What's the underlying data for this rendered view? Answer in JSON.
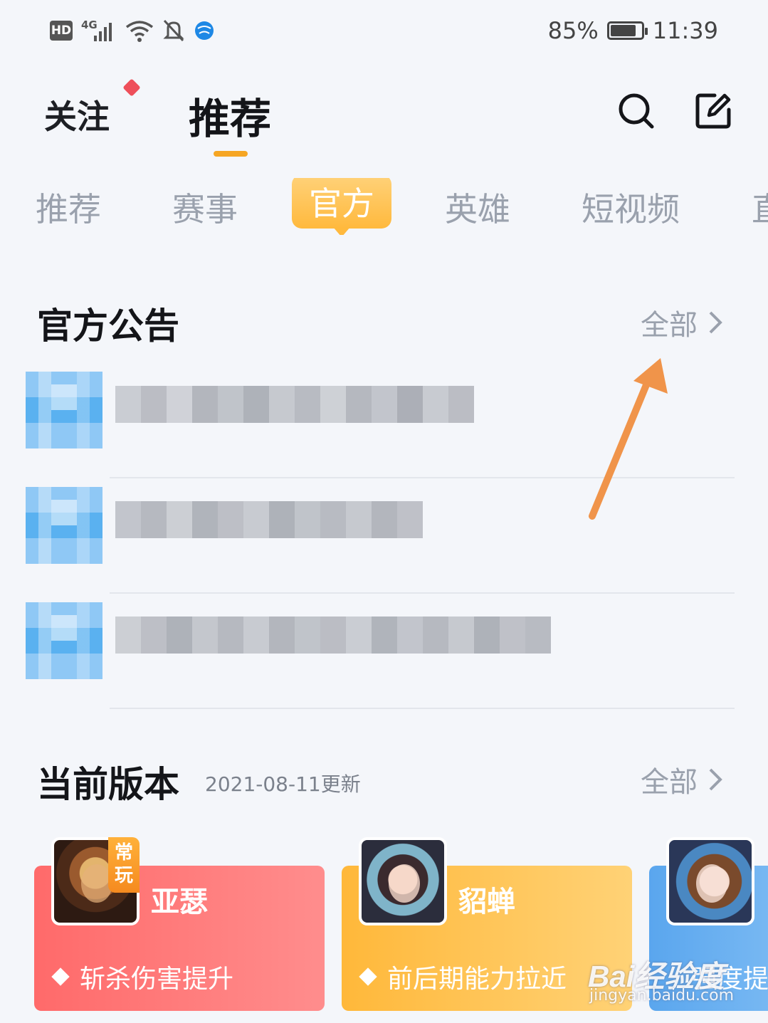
{
  "status_bar": {
    "hd": "HD",
    "network": "4G",
    "battery": "85%",
    "battery_level": 0.85,
    "time": "11:39"
  },
  "header": {
    "follow_label": "关注",
    "recommend_label": "推荐"
  },
  "icons": {
    "search": "search-icon",
    "edit": "edit-icon"
  },
  "tabs": [
    {
      "label": "推荐",
      "active": false
    },
    {
      "label": "赛事",
      "active": false
    },
    {
      "label": "官方",
      "active": true
    },
    {
      "label": "英雄",
      "active": false
    },
    {
      "label": "短视频",
      "active": false
    },
    {
      "label": "直",
      "active": false
    }
  ],
  "announcements": {
    "title": "官方公告",
    "more_label": "全部"
  },
  "version": {
    "title": "当前版本",
    "updated": "2021-08-11更新",
    "more_label": "全部",
    "heroes": [
      {
        "name": "亚瑟",
        "badge": "常玩",
        "desc": "斩杀伤害提升",
        "color": "#ff7474"
      },
      {
        "name": "貂蝉",
        "badge": "",
        "desc": "前后期能力拉近",
        "color": "#ffc557"
      },
      {
        "name": "",
        "badge": "",
        "desc": "强度提",
        "color": "#66adf0"
      }
    ]
  },
  "watermark": {
    "brand": "Bai经验度",
    "url": "jingyan.baidu.com"
  },
  "colors": {
    "accent": "#f6a623",
    "arrow": "#f0944a",
    "red_dot": "#ee4f5a"
  }
}
